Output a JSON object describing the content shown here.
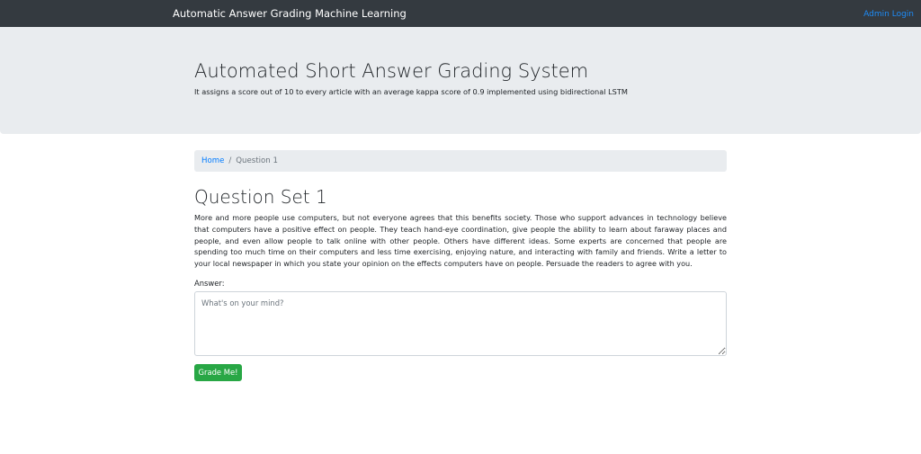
{
  "navbar": {
    "brand": "Automatic Answer Grading Machine Learning",
    "admin_link": "Admin Login"
  },
  "jumbotron": {
    "title": "Automated Short Answer Grading System",
    "lead": "It assigns a score out of 10 to every article with an average kappa score of 0.9 implemented using bidirectional LSTM"
  },
  "breadcrumb": {
    "home": "Home",
    "separator": "/",
    "current": "Question 1"
  },
  "question": {
    "title": "Question Set 1",
    "body": "More and more people use computers, but not everyone agrees that this benefits society. Those who support advances in technology believe that computers have a positive effect on people. They teach hand-eye coordination, give people the ability to learn about faraway places and people, and even allow people to talk online with other people. Others have different ideas. Some experts are concerned that people are spending too much time on their computers and less time exercising, enjoying nature, and interacting with family and friends. Write a letter to your local newspaper in which you state your opinion on the effects computers have on people. Persuade the readers to agree with you."
  },
  "form": {
    "answer_label": "Answer:",
    "answer_placeholder": "What's on your mind?",
    "answer_value": "",
    "submit_label": "Grade Me!"
  },
  "colors": {
    "navbar_bg": "#343a40",
    "jumbotron_bg": "#e9ecef",
    "link": "#007bff",
    "success": "#28a745"
  }
}
